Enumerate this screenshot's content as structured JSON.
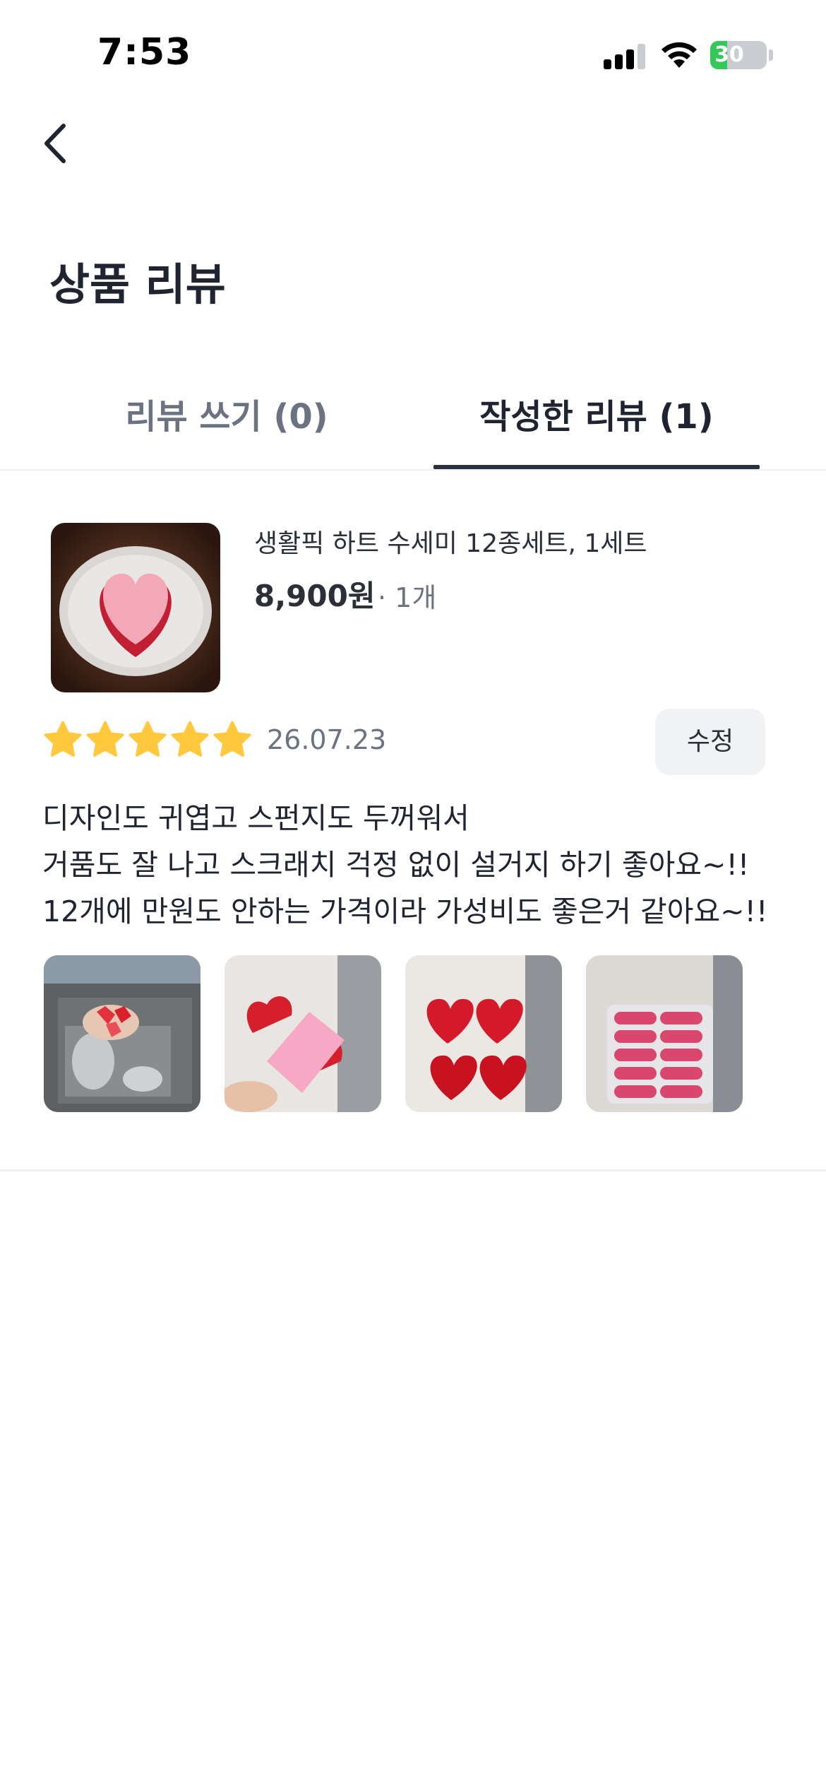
{
  "status_bar": {
    "time": "7:53",
    "battery": "30",
    "battery_level": 0.3
  },
  "header": {
    "back_icon": "chevron-left-icon",
    "title": "상품 리뷰"
  },
  "tabs": [
    {
      "label": "리뷰 쓰기 (0)",
      "active": false
    },
    {
      "label": "작성한 리뷰 (1)",
      "active": true
    }
  ],
  "product": {
    "name": "생활픽 하트 수세미 12종세트, 1세트",
    "price": "8,900원",
    "quantity": "· 1개"
  },
  "review": {
    "rating": 5,
    "date": "26.07.23",
    "edit_label": "수정",
    "lines": [
      "디자인도 귀엽고 스펀지도 두꺼워서",
      "거품도 잘 나고 스크래치 걱정 없이 설거지 하기 좋아요~!!",
      "12개에 만원도 안하는 가격이라 가성비도 좋은거 같아요~!!"
    ],
    "photos": [
      "sink-photo",
      "pink-sponge-photo",
      "red-heart-sponges-photo",
      "packaged-sponges-photo"
    ]
  },
  "colors": {
    "star": "#FFC83D",
    "accent": "#2C323C",
    "muted": "#6B7280"
  }
}
